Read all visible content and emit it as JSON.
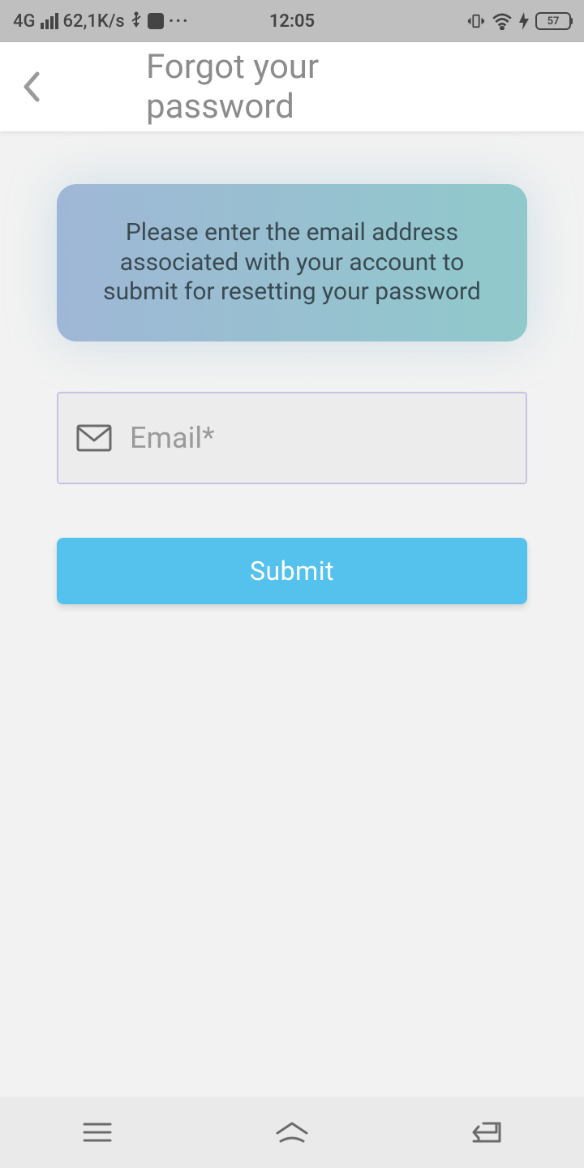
{
  "statusBar": {
    "network": "4G",
    "speed": "62,1K/s",
    "time": "12:05",
    "battery": "57"
  },
  "header": {
    "title": "Forgot your password"
  },
  "card": {
    "text": "Please enter the email address associated with your account to submit for resetting your password"
  },
  "form": {
    "emailPlaceholder": "Email*",
    "submitLabel": "Submit"
  }
}
